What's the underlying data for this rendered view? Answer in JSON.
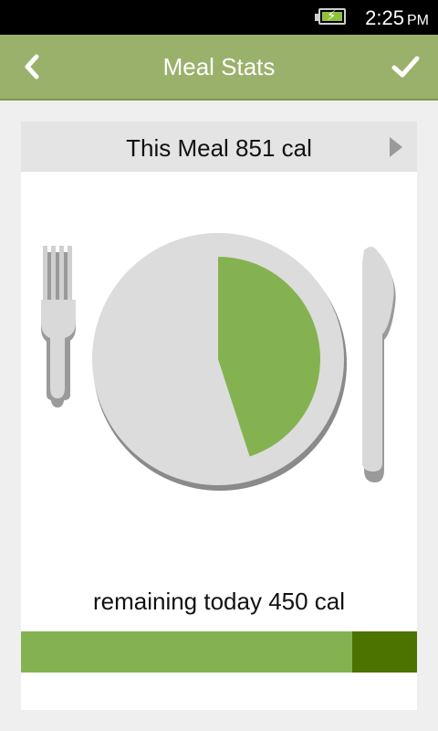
{
  "status_bar": {
    "time": "2:25",
    "ampm": "PM",
    "battery_icon": "battery-charging-icon"
  },
  "app_bar": {
    "title": "Meal Stats",
    "back_icon": "chevron-left-icon",
    "confirm_icon": "checkmark-icon"
  },
  "meal": {
    "header_label": "This Meal 851 cal",
    "next_icon": "triangle-right-icon",
    "plate_fraction": 0.45
  },
  "remaining": {
    "label": "remaining today 450 cal",
    "progress_fraction": 0.836
  },
  "colors": {
    "app_bar": "#9ab16b",
    "accent_green": "#85b250",
    "dark_green": "#4c7300",
    "plate_gray": "#dcdcdc"
  }
}
